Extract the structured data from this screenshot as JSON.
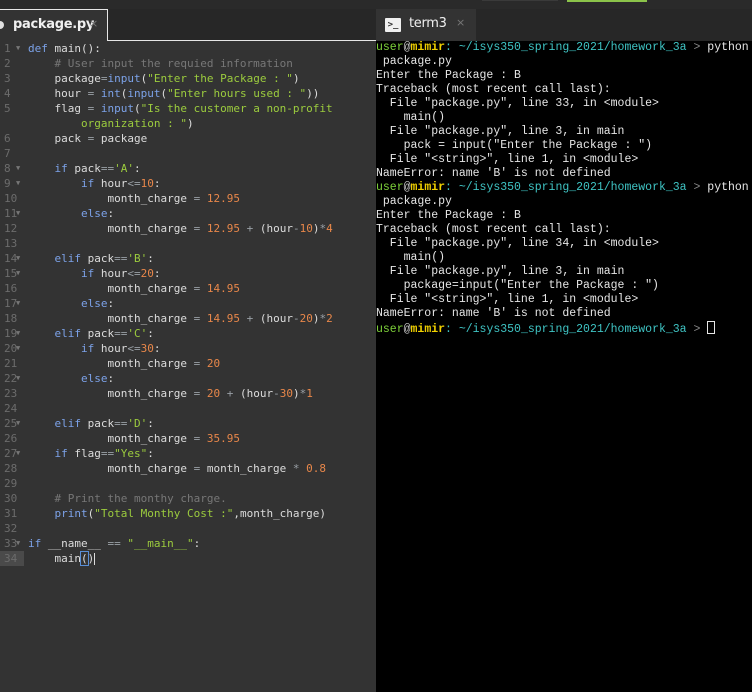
{
  "editor": {
    "tab": {
      "title": "package.py",
      "close": "×"
    },
    "lines": [
      {
        "n": "1",
        "fold": true,
        "html": "<span class='kw'>def</span> main():"
      },
      {
        "n": "2",
        "html": "    <span class='com'># User input the requied information</span>"
      },
      {
        "n": "3",
        "html": "    package<span class='op'>=</span><span class='kw'>input</span>(<span class='str'>\"Enter the Package : \"</span>)"
      },
      {
        "n": "4",
        "html": "    hour <span class='op'>=</span> <span class='kw'>int</span>(<span class='kw'>input</span>(<span class='str'>\"Enter hours used : \"</span>))"
      },
      {
        "n": "5",
        "html": "    flag <span class='op'>=</span> <span class='kw'>input</span>(<span class='str'>\"Is the customer a non-profit</span>"
      },
      {
        "n": "",
        "html": "        <span class='str'>organization : \"</span>)"
      },
      {
        "n": "6",
        "html": "    pack <span class='op'>=</span> package"
      },
      {
        "n": "7",
        "html": ""
      },
      {
        "n": "8",
        "fold": true,
        "html": "    <span class='kw'>if</span> pack<span class='op'>==</span><span class='str'>'A'</span>:"
      },
      {
        "n": "9",
        "fold": true,
        "html": "        <span class='kw'>if</span> hour<span class='op'>&lt;=</span><span class='num'>10</span>:"
      },
      {
        "n": "10",
        "html": "            month_charge <span class='op'>=</span> <span class='num'>12.95</span>"
      },
      {
        "n": "11",
        "fold": true,
        "html": "        <span class='kw'>else</span>:"
      },
      {
        "n": "12",
        "html": "            month_charge <span class='op'>=</span> <span class='num'>12.95</span> <span class='op'>+</span> (hour<span class='op'>-</span><span class='num'>10</span>)<span class='op'>*</span><span class='num'>4</span>"
      },
      {
        "n": "13",
        "html": ""
      },
      {
        "n": "14",
        "fold": true,
        "html": "    <span class='kw'>elif</span> pack<span class='op'>==</span><span class='str'>'B'</span>:"
      },
      {
        "n": "15",
        "fold": true,
        "html": "        <span class='kw'>if</span> hour<span class='op'>&lt;=</span><span class='num'>20</span>:"
      },
      {
        "n": "16",
        "html": "            month_charge <span class='op'>=</span> <span class='num'>14.95</span>"
      },
      {
        "n": "17",
        "fold": true,
        "html": "        <span class='kw'>else</span>:"
      },
      {
        "n": "18",
        "html": "            month_charge <span class='op'>=</span> <span class='num'>14.95</span> <span class='op'>+</span> (hour<span class='op'>-</span><span class='num'>20</span>)<span class='op'>*</span><span class='num'>2</span>"
      },
      {
        "n": "19",
        "fold": true,
        "html": "    <span class='kw'>elif</span> pack<span class='op'>==</span><span class='str'>'C'</span>:"
      },
      {
        "n": "20",
        "fold": true,
        "html": "        <span class='kw'>if</span> hour<span class='op'>&lt;=</span><span class='num'>30</span>:"
      },
      {
        "n": "21",
        "html": "            month_charge <span class='op'>=</span> <span class='num'>20</span>"
      },
      {
        "n": "22",
        "fold": true,
        "html": "        <span class='kw'>else</span>:"
      },
      {
        "n": "23",
        "html": "            month_charge <span class='op'>=</span> <span class='num'>20</span> <span class='op'>+</span> (hour<span class='op'>-</span><span class='num'>30</span>)<span class='op'>*</span><span class='num'>1</span>"
      },
      {
        "n": "24",
        "html": ""
      },
      {
        "n": "25",
        "fold": true,
        "html": "    <span class='kw'>elif</span> pack<span class='op'>==</span><span class='str'>'D'</span>:"
      },
      {
        "n": "26",
        "html": "            month_charge <span class='op'>=</span> <span class='num'>35.95</span>"
      },
      {
        "n": "27",
        "fold": true,
        "html": "    <span class='kw'>if</span> flag<span class='op'>==</span><span class='str'>\"Yes\"</span>:"
      },
      {
        "n": "28",
        "html": "            month_charge <span class='op'>=</span> month_charge <span class='op'>*</span> <span class='num'>0.8</span>"
      },
      {
        "n": "29",
        "html": ""
      },
      {
        "n": "30",
        "html": "    <span class='com'># Print the monthy charge.</span>"
      },
      {
        "n": "31",
        "html": "    <span class='kw'>print</span>(<span class='str'>\"Total Monthy Cost :\"</span>,month_charge)"
      },
      {
        "n": "32",
        "html": ""
      },
      {
        "n": "33",
        "fold": true,
        "html": "<span class='kw'>if</span> __name__ <span class='op'>==</span> <span class='str'>\"__main__\"</span>:"
      },
      {
        "n": "34",
        "active": true,
        "html": "    main<span class='bracket'>(</span>)<span class='cursor'></span>"
      }
    ]
  },
  "terminal": {
    "tab": {
      "title": "term3",
      "close": "×",
      "icon": ">_"
    },
    "prompt": {
      "user": "user",
      "at": "@",
      "host": "mimir",
      "path": ": ~/isys350_spring_2021/homework_3a",
      "gt": " > "
    },
    "lines": [
      {
        "type": "prompt",
        "cmd": "python"
      },
      {
        "type": "text",
        "text": " package.py"
      },
      {
        "type": "text",
        "text": "Enter the Package : B"
      },
      {
        "type": "text",
        "text": "Traceback (most recent call last):"
      },
      {
        "type": "text",
        "text": "  File \"package.py\", line 33, in <module>"
      },
      {
        "type": "text",
        "text": "    main()"
      },
      {
        "type": "text",
        "text": "  File \"package.py\", line 3, in main"
      },
      {
        "type": "text",
        "text": "    pack = input(\"Enter the Package : \")"
      },
      {
        "type": "text",
        "text": "  File \"<string>\", line 1, in <module>"
      },
      {
        "type": "text",
        "text": "NameError: name 'B' is not defined"
      },
      {
        "type": "prompt",
        "cmd": "python"
      },
      {
        "type": "text",
        "text": " package.py"
      },
      {
        "type": "text",
        "text": "Enter the Package : B"
      },
      {
        "type": "text",
        "text": "Traceback (most recent call last):"
      },
      {
        "type": "text",
        "text": "  File \"package.py\", line 34, in <module>"
      },
      {
        "type": "text",
        "text": "    main()"
      },
      {
        "type": "text",
        "text": "  File \"package.py\", line 3, in main"
      },
      {
        "type": "text",
        "text": "    package=input(\"Enter the Package : \")"
      },
      {
        "type": "text",
        "text": "  File \"<string>\", line 1, in <module>"
      },
      {
        "type": "text",
        "text": "NameError: name 'B' is not defined"
      },
      {
        "type": "prompt",
        "cmd": "",
        "cursor": true
      }
    ]
  }
}
